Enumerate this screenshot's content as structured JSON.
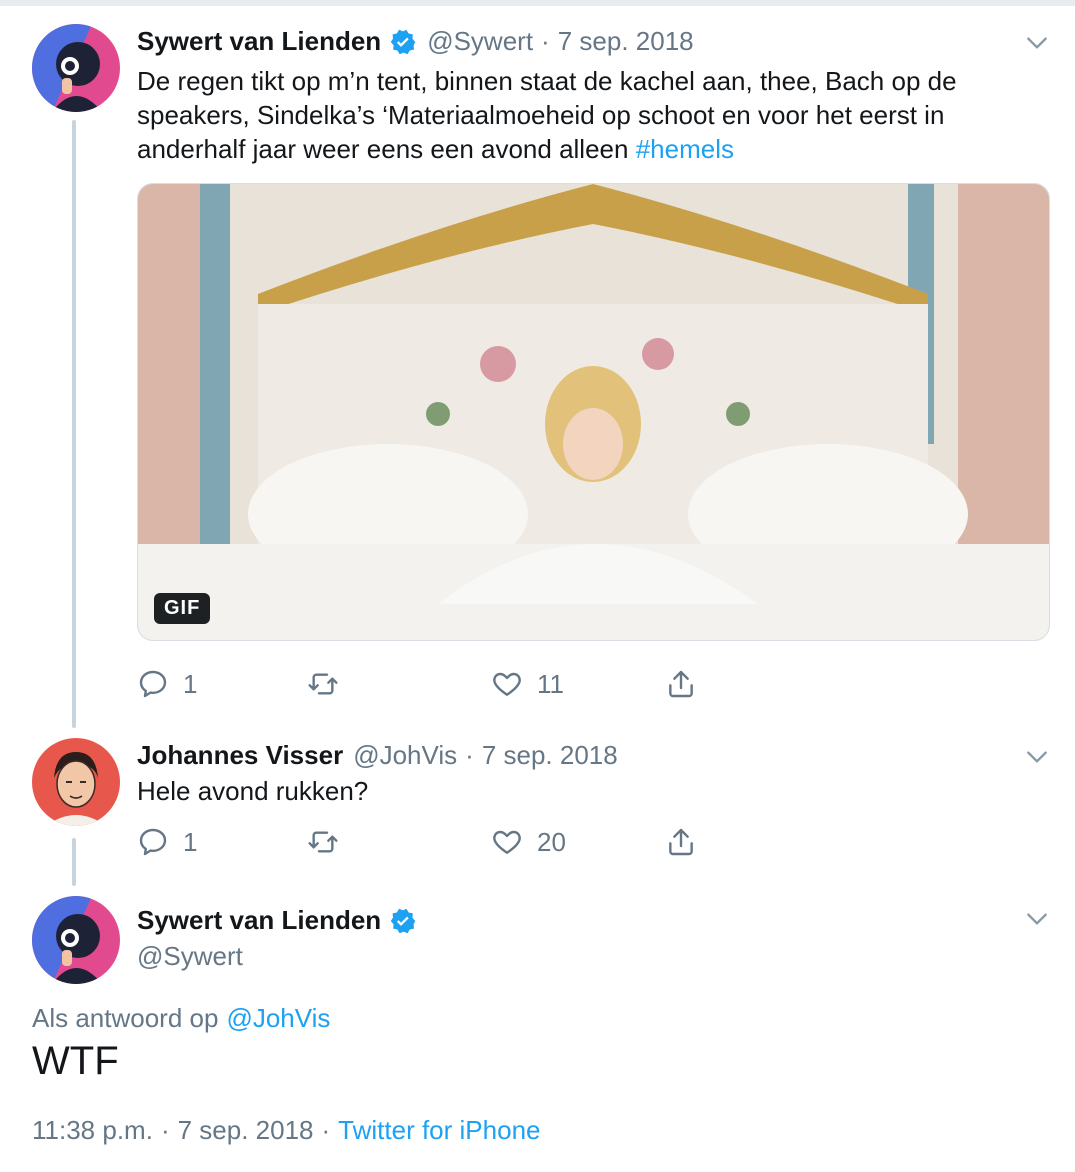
{
  "tweets": [
    {
      "author": "Sywert van Lienden",
      "handle": "@Sywert",
      "separator": "·",
      "date": "7 sep. 2018",
      "text": "De regen tikt op m’n tent, binnen staat de kachel aan, thee, Bach op de speakers, Sindelka’s ‘Materiaalmoeheid op schoot en voor het eerst in anderhalf jaar weer eens een avond alleen",
      "hashtag": "#hemels",
      "media_badge": "GIF",
      "replies": "1",
      "likes": "11",
      "verified": true
    },
    {
      "author": "Johannes Visser",
      "handle": "@JohVis",
      "separator": "·",
      "date": "7 sep. 2018",
      "text": "Hele avond rukken?",
      "replies": "1",
      "likes": "20"
    }
  ],
  "main_tweet": {
    "author": "Sywert van Lienden",
    "handle": "@Sywert",
    "reply_prefix": "Als antwoord op",
    "reply_to": "@JohVis",
    "text": "WTF",
    "time": "11:38 p.m.",
    "separator": "·",
    "date": "7 sep. 2018",
    "separator2": "·",
    "source": "Twitter for iPhone",
    "verified": true
  },
  "colors": {
    "accent": "#1da1f2",
    "muted": "#657786",
    "thread_line": "#c9d3db"
  },
  "icons": [
    "verified-badge-icon",
    "chevron-down-icon",
    "reply-icon",
    "retweet-icon",
    "like-icon",
    "share-icon"
  ]
}
